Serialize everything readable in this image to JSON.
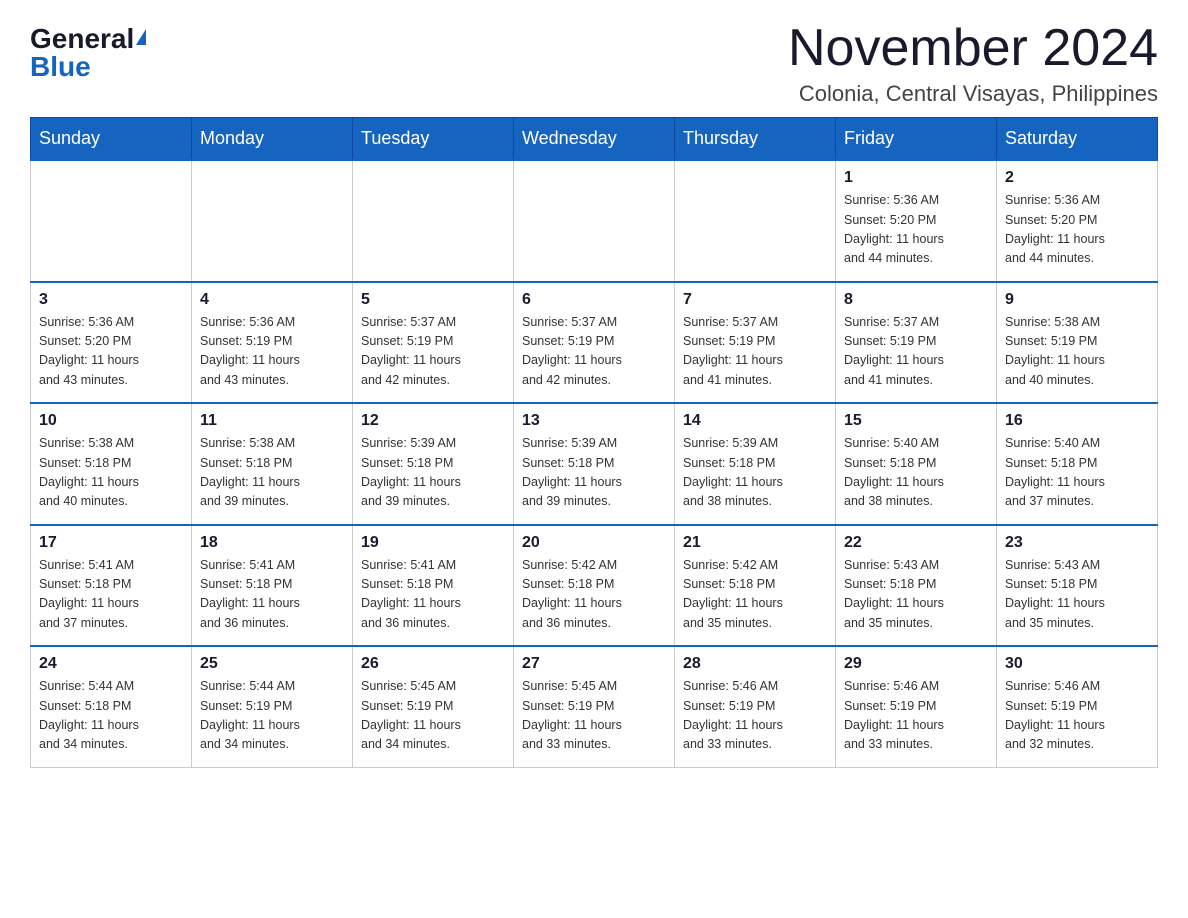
{
  "logo": {
    "general": "General",
    "blue": "Blue"
  },
  "title": "November 2024",
  "subtitle": "Colonia, Central Visayas, Philippines",
  "days_of_week": [
    "Sunday",
    "Monday",
    "Tuesday",
    "Wednesday",
    "Thursday",
    "Friday",
    "Saturday"
  ],
  "weeks": [
    [
      {
        "day": "",
        "info": ""
      },
      {
        "day": "",
        "info": ""
      },
      {
        "day": "",
        "info": ""
      },
      {
        "day": "",
        "info": ""
      },
      {
        "day": "",
        "info": ""
      },
      {
        "day": "1",
        "info": "Sunrise: 5:36 AM\nSunset: 5:20 PM\nDaylight: 11 hours\nand 44 minutes."
      },
      {
        "day": "2",
        "info": "Sunrise: 5:36 AM\nSunset: 5:20 PM\nDaylight: 11 hours\nand 44 minutes."
      }
    ],
    [
      {
        "day": "3",
        "info": "Sunrise: 5:36 AM\nSunset: 5:20 PM\nDaylight: 11 hours\nand 43 minutes."
      },
      {
        "day": "4",
        "info": "Sunrise: 5:36 AM\nSunset: 5:19 PM\nDaylight: 11 hours\nand 43 minutes."
      },
      {
        "day": "5",
        "info": "Sunrise: 5:37 AM\nSunset: 5:19 PM\nDaylight: 11 hours\nand 42 minutes."
      },
      {
        "day": "6",
        "info": "Sunrise: 5:37 AM\nSunset: 5:19 PM\nDaylight: 11 hours\nand 42 minutes."
      },
      {
        "day": "7",
        "info": "Sunrise: 5:37 AM\nSunset: 5:19 PM\nDaylight: 11 hours\nand 41 minutes."
      },
      {
        "day": "8",
        "info": "Sunrise: 5:37 AM\nSunset: 5:19 PM\nDaylight: 11 hours\nand 41 minutes."
      },
      {
        "day": "9",
        "info": "Sunrise: 5:38 AM\nSunset: 5:19 PM\nDaylight: 11 hours\nand 40 minutes."
      }
    ],
    [
      {
        "day": "10",
        "info": "Sunrise: 5:38 AM\nSunset: 5:18 PM\nDaylight: 11 hours\nand 40 minutes."
      },
      {
        "day": "11",
        "info": "Sunrise: 5:38 AM\nSunset: 5:18 PM\nDaylight: 11 hours\nand 39 minutes."
      },
      {
        "day": "12",
        "info": "Sunrise: 5:39 AM\nSunset: 5:18 PM\nDaylight: 11 hours\nand 39 minutes."
      },
      {
        "day": "13",
        "info": "Sunrise: 5:39 AM\nSunset: 5:18 PM\nDaylight: 11 hours\nand 39 minutes."
      },
      {
        "day": "14",
        "info": "Sunrise: 5:39 AM\nSunset: 5:18 PM\nDaylight: 11 hours\nand 38 minutes."
      },
      {
        "day": "15",
        "info": "Sunrise: 5:40 AM\nSunset: 5:18 PM\nDaylight: 11 hours\nand 38 minutes."
      },
      {
        "day": "16",
        "info": "Sunrise: 5:40 AM\nSunset: 5:18 PM\nDaylight: 11 hours\nand 37 minutes."
      }
    ],
    [
      {
        "day": "17",
        "info": "Sunrise: 5:41 AM\nSunset: 5:18 PM\nDaylight: 11 hours\nand 37 minutes."
      },
      {
        "day": "18",
        "info": "Sunrise: 5:41 AM\nSunset: 5:18 PM\nDaylight: 11 hours\nand 36 minutes."
      },
      {
        "day": "19",
        "info": "Sunrise: 5:41 AM\nSunset: 5:18 PM\nDaylight: 11 hours\nand 36 minutes."
      },
      {
        "day": "20",
        "info": "Sunrise: 5:42 AM\nSunset: 5:18 PM\nDaylight: 11 hours\nand 36 minutes."
      },
      {
        "day": "21",
        "info": "Sunrise: 5:42 AM\nSunset: 5:18 PM\nDaylight: 11 hours\nand 35 minutes."
      },
      {
        "day": "22",
        "info": "Sunrise: 5:43 AM\nSunset: 5:18 PM\nDaylight: 11 hours\nand 35 minutes."
      },
      {
        "day": "23",
        "info": "Sunrise: 5:43 AM\nSunset: 5:18 PM\nDaylight: 11 hours\nand 35 minutes."
      }
    ],
    [
      {
        "day": "24",
        "info": "Sunrise: 5:44 AM\nSunset: 5:18 PM\nDaylight: 11 hours\nand 34 minutes."
      },
      {
        "day": "25",
        "info": "Sunrise: 5:44 AM\nSunset: 5:19 PM\nDaylight: 11 hours\nand 34 minutes."
      },
      {
        "day": "26",
        "info": "Sunrise: 5:45 AM\nSunset: 5:19 PM\nDaylight: 11 hours\nand 34 minutes."
      },
      {
        "day": "27",
        "info": "Sunrise: 5:45 AM\nSunset: 5:19 PM\nDaylight: 11 hours\nand 33 minutes."
      },
      {
        "day": "28",
        "info": "Sunrise: 5:46 AM\nSunset: 5:19 PM\nDaylight: 11 hours\nand 33 minutes."
      },
      {
        "day": "29",
        "info": "Sunrise: 5:46 AM\nSunset: 5:19 PM\nDaylight: 11 hours\nand 33 minutes."
      },
      {
        "day": "30",
        "info": "Sunrise: 5:46 AM\nSunset: 5:19 PM\nDaylight: 11 hours\nand 32 minutes."
      }
    ]
  ]
}
